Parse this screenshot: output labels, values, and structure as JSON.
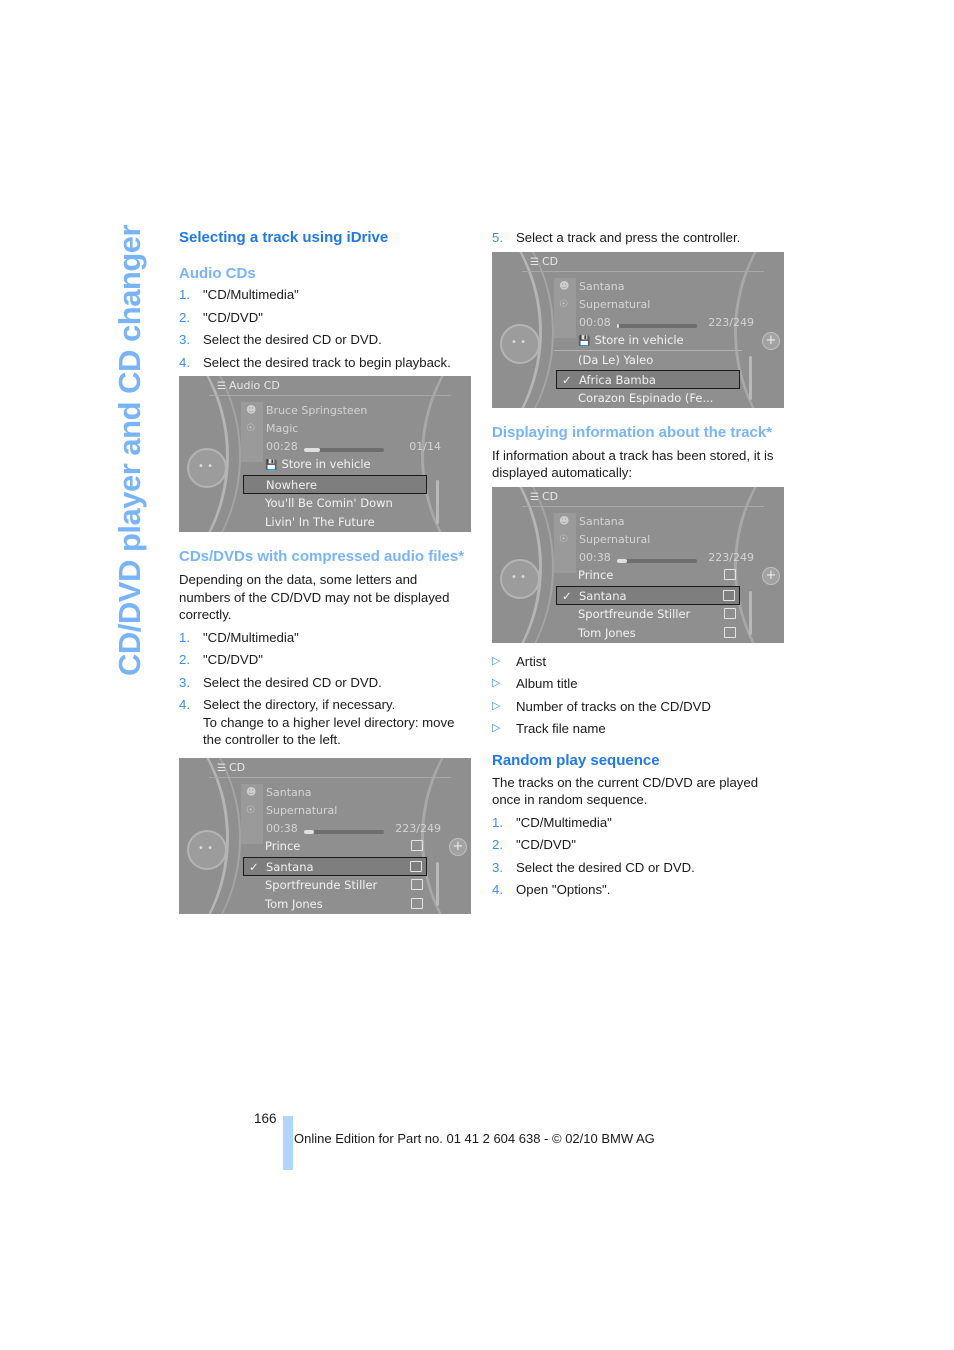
{
  "side_title": "CD/DVD player and CD changer",
  "left": {
    "heading": "Selecting a track using iDrive",
    "audio_cds": {
      "title": "Audio CDs",
      "steps": [
        {
          "num": "1.",
          "text": "\"CD/Multimedia\""
        },
        {
          "num": "2.",
          "text": "\"CD/DVD\""
        },
        {
          "num": "3.",
          "text": "Select the desired CD or DVD."
        },
        {
          "num": "4.",
          "text": "Select the desired track to begin playback."
        }
      ],
      "screen": {
        "header": "Audio CD",
        "artist": "Bruce Springsteen",
        "album": "Magic",
        "time": "00:28",
        "progress": 0.2,
        "count": "01/14",
        "store": "Store in vehicle",
        "tracks": [
          "Nowhere",
          "You'll Be Comin' Down",
          "Livin' In The Future"
        ],
        "selected": "Nowhere"
      }
    },
    "compressed": {
      "title": "CDs/DVDs with compressed audio files*",
      "intro": "Depending on the data, some letters and numbers of the CD/DVD may not be displayed correctly.",
      "steps": [
        {
          "num": "1.",
          "text": "\"CD/Multimedia\""
        },
        {
          "num": "2.",
          "text": "\"CD/DVD\""
        },
        {
          "num": "3.",
          "text": "Select the desired CD or DVD."
        },
        {
          "num": "4.",
          "text": "Select the directory, if necessary.",
          "note": "To change to a higher level directory: move the controller to the left."
        }
      ],
      "screen": {
        "header": "CD",
        "artist": "Santana",
        "album": "Supernatural",
        "time": "00:38",
        "progress": 0.12,
        "count": "223/249",
        "items": [
          "Prince",
          "Santana",
          "Sportfreunde Stiller",
          "Tom Jones"
        ],
        "selected": "Santana"
      }
    }
  },
  "right": {
    "step5": {
      "num": "5.",
      "text": "Select a track and press the controller."
    },
    "screen1": {
      "header": "CD",
      "artist": "Santana",
      "album": "Supernatural",
      "time": "00:08",
      "progress": 0.03,
      "count": "223/249",
      "store": "Store in vehicle",
      "tracks": [
        "(Da Le) Yaleo",
        "Africa Bamba",
        "Corazon Espinado (Fe..."
      ],
      "selected": "Africa Bamba"
    },
    "display_info": {
      "title": "Displaying information about the track*",
      "intro": "If information about a track has been stored, it is displayed automatically:",
      "screen": {
        "header": "CD",
        "artist": "Santana",
        "album": "Supernatural",
        "time": "00:38",
        "progress": 0.12,
        "count": "223/249",
        "items": [
          "Prince",
          "Santana",
          "Sportfreunde Stiller",
          "Tom Jones"
        ],
        "selected": "Santana"
      },
      "bullets": [
        "Artist",
        "Album title",
        "Number of tracks on the CD/DVD",
        "Track file name"
      ]
    },
    "random": {
      "title": "Random play sequence",
      "intro": "The tracks on the current CD/DVD are played once in random sequence.",
      "steps": [
        {
          "num": "1.",
          "text": "\"CD/Multimedia\""
        },
        {
          "num": "2.",
          "text": "\"CD/DVD\""
        },
        {
          "num": "3.",
          "text": "Select the desired CD or DVD."
        },
        {
          "num": "4.",
          "text": "Open \"Options\"."
        }
      ]
    }
  },
  "footer": {
    "page_number": "166",
    "edition": "Online Edition for Part no. 01 41 2 604 638 - © 02/10 BMW AG"
  },
  "colors": {
    "heading_blue": "#1f78f0",
    "subheading_light_blue": "#78b4fa",
    "side_title": "#78b4fa",
    "footer_bar": "#b3d4fc"
  }
}
